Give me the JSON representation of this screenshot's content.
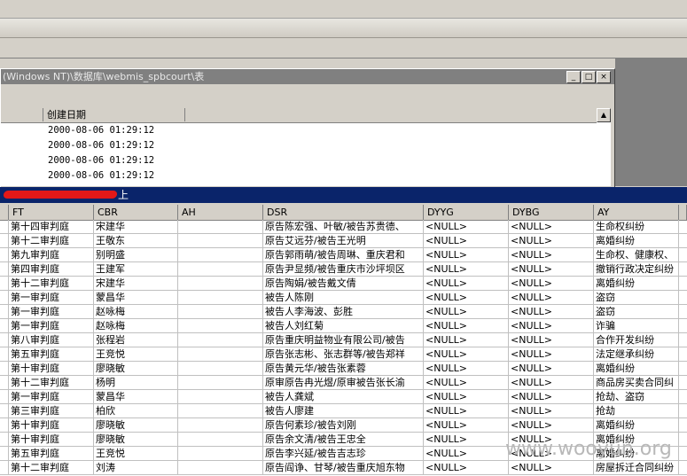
{
  "window1": {
    "title": "(Windows NT)\\数据库\\webmis_spbcourt\\表",
    "column_header": "创建日期",
    "scroll_up": "▲",
    "dates": [
      "2000-08-06 01:29:12",
      "2000-08-06 01:29:12",
      "2000-08-06 01:29:12",
      "2000-08-06 01:29:12"
    ]
  },
  "window2": {
    "title_suffix": "上",
    "columns": [
      "FT",
      "CBR",
      "AH",
      "DSR",
      "DYYG",
      "DYBG",
      "AY"
    ],
    "rows": [
      [
        "第十四审判庭",
        "宋建华",
        "",
        "原告陈宏强、叶敏/被告苏贵德、",
        "<NULL>",
        "<NULL>",
        "生命权纠纷"
      ],
      [
        "第十二审判庭",
        "王敬东",
        "",
        "原告艾远芬/被告王光明",
        "<NULL>",
        "<NULL>",
        "离婚纠纷"
      ],
      [
        "第九审判庭",
        "别明盛",
        "",
        "原告郭雨萌/被告周琳、重庆君和",
        "<NULL>",
        "<NULL>",
        "生命权、健康权、"
      ],
      [
        "第四审判庭",
        "王建军",
        "",
        "原告尹显频/被告重庆市沙坪坝区",
        "<NULL>",
        "<NULL>",
        "撤销行政决定纠纷"
      ],
      [
        "第十二审判庭",
        "宋建华",
        "",
        "原告陶娟/被告戴文倩",
        "<NULL>",
        "<NULL>",
        "离婚纠纷"
      ],
      [
        "第一审判庭",
        "蒙昌华",
        "",
        "被告人陈刚",
        "<NULL>",
        "<NULL>",
        "盗窃"
      ],
      [
        "第一审判庭",
        "赵咏梅",
        "",
        "被告人李海波、彭胜",
        "<NULL>",
        "<NULL>",
        "盗窃"
      ],
      [
        "第一审判庭",
        "赵咏梅",
        "",
        "被告人刘红菊",
        "<NULL>",
        "<NULL>",
        "诈骗"
      ],
      [
        "第八审判庭",
        "张程岩",
        "",
        "原告重庆明益物业有限公司/被告",
        "<NULL>",
        "<NULL>",
        "合作开发纠纷"
      ],
      [
        "第五审判庭",
        "王竞悦",
        "",
        "原告张志彬、张志群等/被告郑祥",
        "<NULL>",
        "<NULL>",
        "法定继承纠纷"
      ],
      [
        "第十审判庭",
        "廖晓敏",
        "",
        "原告黄元华/被告张素蓉",
        "<NULL>",
        "<NULL>",
        "离婚纠纷"
      ],
      [
        "第十二审判庭",
        "杨明",
        "",
        "原审原告冉光煜/原审被告张长渝",
        "<NULL>",
        "<NULL>",
        "商品房买卖合同纠"
      ],
      [
        "第一审判庭",
        "蒙昌华",
        "",
        "被告人龚斌",
        "<NULL>",
        "<NULL>",
        "抢劫、盗窃"
      ],
      [
        "第三审判庭",
        "柏欣",
        "",
        "被告人廖建",
        "<NULL>",
        "<NULL>",
        "抢劫"
      ],
      [
        "第十审判庭",
        "廖晓敏",
        "",
        "原告何素珍/被告刘刚",
        "<NULL>",
        "<NULL>",
        "离婚纠纷"
      ],
      [
        "第十审判庭",
        "廖晓敏",
        "",
        "原告余文清/被告王忠全",
        "<NULL>",
        "<NULL>",
        "离婚纠纷"
      ],
      [
        "第五审判庭",
        "王竞悦",
        "",
        "原告李兴延/被告吉志珍",
        "<NULL>",
        "<NULL>",
        "离婚纠纷"
      ],
      [
        "第十二审判庭",
        "刘涛",
        "",
        "原告阎诤、甘琴/被告重庆旭东物",
        "<NULL>",
        "<NULL>",
        "房屋拆迁合同纠纷"
      ]
    ]
  },
  "watermark": "www.wooyun.org"
}
